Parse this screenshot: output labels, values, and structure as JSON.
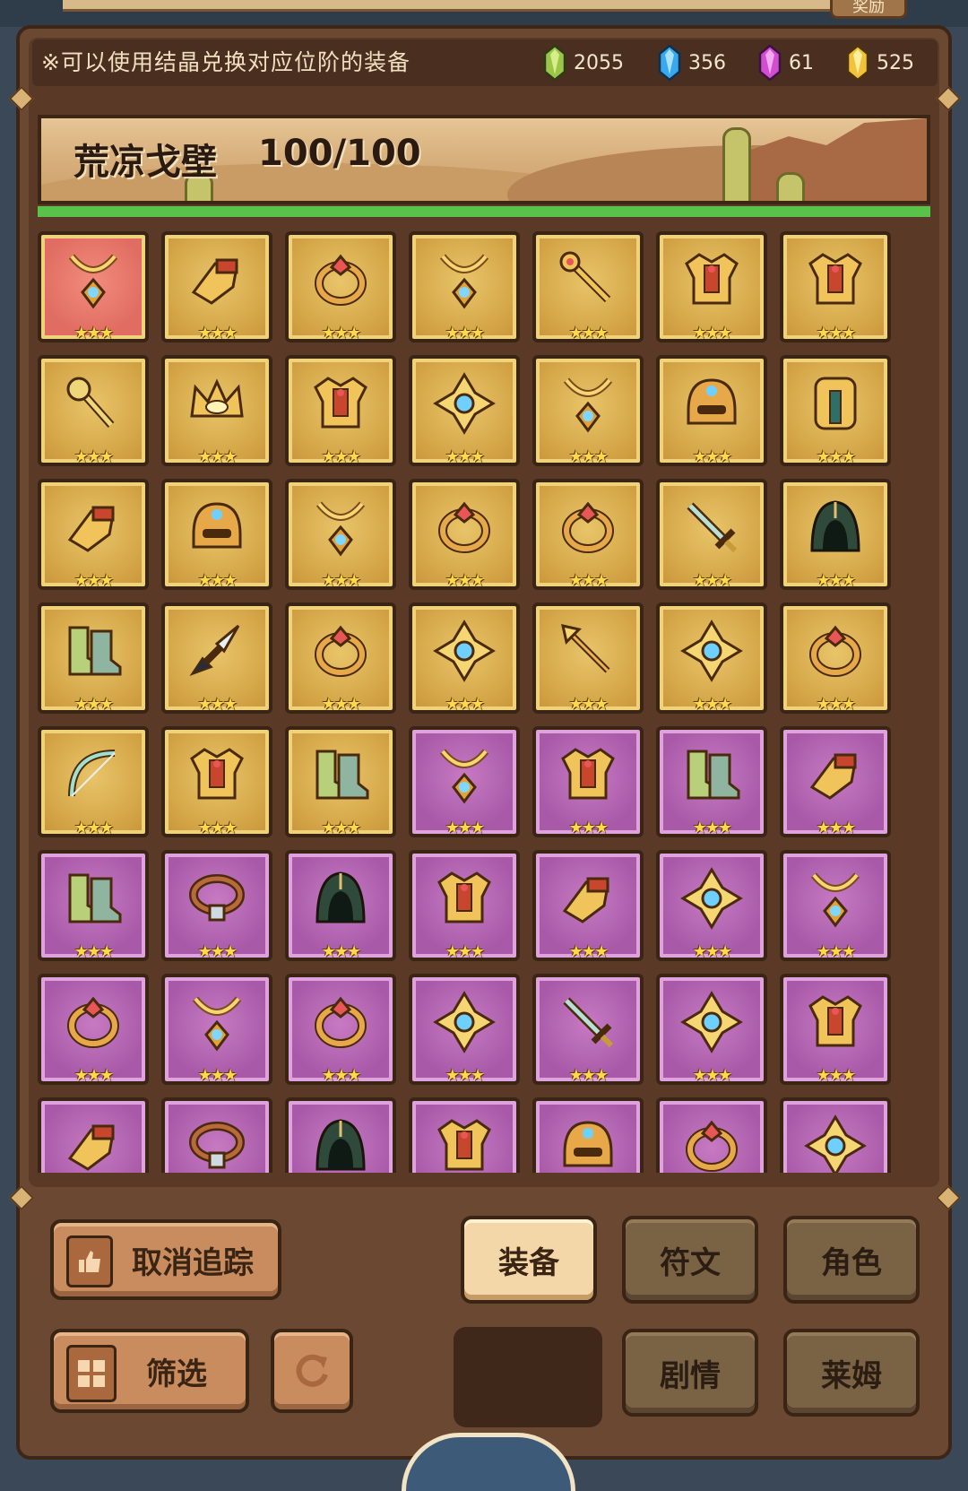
{
  "header": {
    "reward_tab": "奖励",
    "notice": "※可以使用结晶兑换对应位阶的装备",
    "currencies": [
      {
        "name": "green-crystal-icon",
        "value": "2055",
        "color": "#9cc64a"
      },
      {
        "name": "blue-crystal-icon",
        "value": "356",
        "color": "#3aa8f0"
      },
      {
        "name": "purple-crystal-icon",
        "value": "61",
        "color": "#d24ed0"
      },
      {
        "name": "gold-crystal-icon",
        "value": "525",
        "color": "#f2c23a"
      }
    ]
  },
  "banner": {
    "title": "荒凉戈壁",
    "progress_text": "100/100",
    "progress_fraction": 1.0
  },
  "grid": {
    "stars": "★★★",
    "items": [
      {
        "icon": "necklace-icon",
        "bg": "red"
      },
      {
        "icon": "gauntlet-icon",
        "bg": "gold"
      },
      {
        "icon": "ring-icon",
        "bg": "gold"
      },
      {
        "icon": "necklace-icon",
        "bg": "gold"
      },
      {
        "icon": "scepter-icon",
        "bg": "gold"
      },
      {
        "icon": "chest-armor-icon",
        "bg": "gold"
      },
      {
        "icon": "chest-armor-icon",
        "bg": "gold"
      },
      {
        "icon": "mace-icon",
        "bg": "gold"
      },
      {
        "icon": "crown-icon",
        "bg": "gold"
      },
      {
        "icon": "chest-armor-icon",
        "bg": "gold"
      },
      {
        "icon": "amulet-icon",
        "bg": "gold"
      },
      {
        "icon": "necklace-icon",
        "bg": "gold"
      },
      {
        "icon": "helmet-icon",
        "bg": "gold"
      },
      {
        "icon": "greaves-icon",
        "bg": "gold"
      },
      {
        "icon": "gauntlet-icon",
        "bg": "gold"
      },
      {
        "icon": "helmet-icon",
        "bg": "gold"
      },
      {
        "icon": "necklace-icon",
        "bg": "gold"
      },
      {
        "icon": "ring-icon",
        "bg": "gold"
      },
      {
        "icon": "ring-icon",
        "bg": "gold"
      },
      {
        "icon": "sword-icon",
        "bg": "gold"
      },
      {
        "icon": "hood-icon",
        "bg": "gold"
      },
      {
        "icon": "boots-icon",
        "bg": "gold"
      },
      {
        "icon": "dagger-icon",
        "bg": "gold"
      },
      {
        "icon": "ring-icon",
        "bg": "gold"
      },
      {
        "icon": "amulet-icon",
        "bg": "gold"
      },
      {
        "icon": "spear-icon",
        "bg": "gold"
      },
      {
        "icon": "amulet-icon",
        "bg": "gold"
      },
      {
        "icon": "ring-icon",
        "bg": "gold"
      },
      {
        "icon": "bow-icon",
        "bg": "gold"
      },
      {
        "icon": "chest-armor-icon",
        "bg": "gold"
      },
      {
        "icon": "boots-icon",
        "bg": "gold"
      },
      {
        "icon": "necklace-icon",
        "bg": "purple"
      },
      {
        "icon": "chest-armor-icon",
        "bg": "purple"
      },
      {
        "icon": "boots-icon",
        "bg": "purple"
      },
      {
        "icon": "gauntlet-icon",
        "bg": "purple"
      },
      {
        "icon": "boots-icon",
        "bg": "purple"
      },
      {
        "icon": "belt-icon",
        "bg": "purple"
      },
      {
        "icon": "hood-icon",
        "bg": "purple"
      },
      {
        "icon": "chest-armor-icon",
        "bg": "purple"
      },
      {
        "icon": "gauntlet-icon",
        "bg": "purple"
      },
      {
        "icon": "amulet-icon",
        "bg": "purple"
      },
      {
        "icon": "necklace-icon",
        "bg": "purple"
      },
      {
        "icon": "ring-icon",
        "bg": "purple"
      },
      {
        "icon": "necklace-icon",
        "bg": "purple"
      },
      {
        "icon": "ring-icon",
        "bg": "purple"
      },
      {
        "icon": "amulet-icon",
        "bg": "purple"
      },
      {
        "icon": "sword-icon",
        "bg": "purple"
      },
      {
        "icon": "amulet-icon",
        "bg": "purple"
      },
      {
        "icon": "chest-armor-icon",
        "bg": "purple"
      },
      {
        "icon": "gauntlet-icon",
        "bg": "purple"
      },
      {
        "icon": "belt-icon",
        "bg": "purple"
      },
      {
        "icon": "hood-icon",
        "bg": "purple"
      },
      {
        "icon": "chest-armor-icon",
        "bg": "purple"
      },
      {
        "icon": "helmet-icon",
        "bg": "purple"
      },
      {
        "icon": "ring-icon",
        "bg": "purple"
      },
      {
        "icon": "amulet-icon",
        "bg": "purple"
      }
    ]
  },
  "buttons": {
    "untrack": "取消追踪",
    "filter": "筛选",
    "equipment": "装备",
    "rune": "符文",
    "character": "角色",
    "story": "剧情",
    "slime": "莱姆"
  }
}
